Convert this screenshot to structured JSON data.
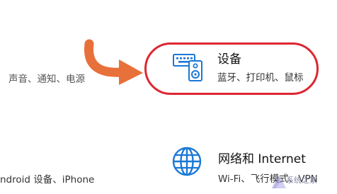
{
  "settings": {
    "system": {
      "description": "声音、通知、电源"
    },
    "devices": {
      "title": "设备",
      "description": "蓝牙、打印机、鼠标",
      "icon": "devices-keyboard-speaker-icon",
      "highlight_color": "#dd2730"
    },
    "phone": {
      "description": "ndroid 设备、iPhone"
    },
    "network": {
      "title": "网络和 Internet",
      "description": "Wi-Fi、飞行模式、VPN",
      "icon": "globe-icon"
    }
  },
  "annotation": {
    "arrow_color": "#e8703a",
    "arrow_icon": "curved-arrow-right-icon"
  },
  "watermark": {
    "text": "系统之家"
  }
}
